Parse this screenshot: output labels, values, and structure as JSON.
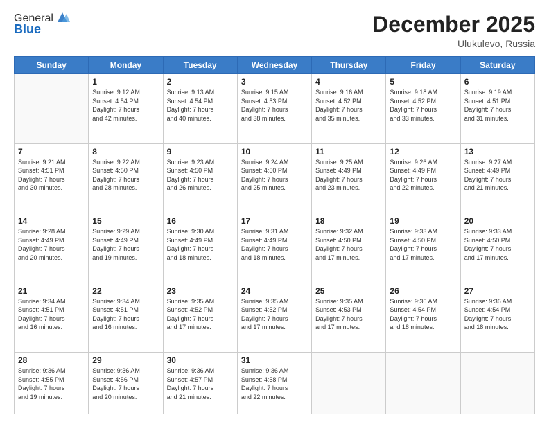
{
  "logo": {
    "general": "General",
    "blue": "Blue"
  },
  "header": {
    "month": "December 2025",
    "location": "Ulukulevo, Russia"
  },
  "weekdays": [
    "Sunday",
    "Monday",
    "Tuesday",
    "Wednesday",
    "Thursday",
    "Friday",
    "Saturday"
  ],
  "weeks": [
    [
      {
        "day": null,
        "info": null
      },
      {
        "day": "1",
        "sunrise": "Sunrise: 9:12 AM",
        "sunset": "Sunset: 4:54 PM",
        "daylight": "Daylight: 7 hours and 42 minutes."
      },
      {
        "day": "2",
        "sunrise": "Sunrise: 9:13 AM",
        "sunset": "Sunset: 4:54 PM",
        "daylight": "Daylight: 7 hours and 40 minutes."
      },
      {
        "day": "3",
        "sunrise": "Sunrise: 9:15 AM",
        "sunset": "Sunset: 4:53 PM",
        "daylight": "Daylight: 7 hours and 38 minutes."
      },
      {
        "day": "4",
        "sunrise": "Sunrise: 9:16 AM",
        "sunset": "Sunset: 4:52 PM",
        "daylight": "Daylight: 7 hours and 35 minutes."
      },
      {
        "day": "5",
        "sunrise": "Sunrise: 9:18 AM",
        "sunset": "Sunset: 4:52 PM",
        "daylight": "Daylight: 7 hours and 33 minutes."
      },
      {
        "day": "6",
        "sunrise": "Sunrise: 9:19 AM",
        "sunset": "Sunset: 4:51 PM",
        "daylight": "Daylight: 7 hours and 31 minutes."
      }
    ],
    [
      {
        "day": "7",
        "sunrise": "Sunrise: 9:21 AM",
        "sunset": "Sunset: 4:51 PM",
        "daylight": "Daylight: 7 hours and 30 minutes."
      },
      {
        "day": "8",
        "sunrise": "Sunrise: 9:22 AM",
        "sunset": "Sunset: 4:50 PM",
        "daylight": "Daylight: 7 hours and 28 minutes."
      },
      {
        "day": "9",
        "sunrise": "Sunrise: 9:23 AM",
        "sunset": "Sunset: 4:50 PM",
        "daylight": "Daylight: 7 hours and 26 minutes."
      },
      {
        "day": "10",
        "sunrise": "Sunrise: 9:24 AM",
        "sunset": "Sunset: 4:50 PM",
        "daylight": "Daylight: 7 hours and 25 minutes."
      },
      {
        "day": "11",
        "sunrise": "Sunrise: 9:25 AM",
        "sunset": "Sunset: 4:49 PM",
        "daylight": "Daylight: 7 hours and 23 minutes."
      },
      {
        "day": "12",
        "sunrise": "Sunrise: 9:26 AM",
        "sunset": "Sunset: 4:49 PM",
        "daylight": "Daylight: 7 hours and 22 minutes."
      },
      {
        "day": "13",
        "sunrise": "Sunrise: 9:27 AM",
        "sunset": "Sunset: 4:49 PM",
        "daylight": "Daylight: 7 hours and 21 minutes."
      }
    ],
    [
      {
        "day": "14",
        "sunrise": "Sunrise: 9:28 AM",
        "sunset": "Sunset: 4:49 PM",
        "daylight": "Daylight: 7 hours and 20 minutes."
      },
      {
        "day": "15",
        "sunrise": "Sunrise: 9:29 AM",
        "sunset": "Sunset: 4:49 PM",
        "daylight": "Daylight: 7 hours and 19 minutes."
      },
      {
        "day": "16",
        "sunrise": "Sunrise: 9:30 AM",
        "sunset": "Sunset: 4:49 PM",
        "daylight": "Daylight: 7 hours and 18 minutes."
      },
      {
        "day": "17",
        "sunrise": "Sunrise: 9:31 AM",
        "sunset": "Sunset: 4:49 PM",
        "daylight": "Daylight: 7 hours and 18 minutes."
      },
      {
        "day": "18",
        "sunrise": "Sunrise: 9:32 AM",
        "sunset": "Sunset: 4:50 PM",
        "daylight": "Daylight: 7 hours and 17 minutes."
      },
      {
        "day": "19",
        "sunrise": "Sunrise: 9:33 AM",
        "sunset": "Sunset: 4:50 PM",
        "daylight": "Daylight: 7 hours and 17 minutes."
      },
      {
        "day": "20",
        "sunrise": "Sunrise: 9:33 AM",
        "sunset": "Sunset: 4:50 PM",
        "daylight": "Daylight: 7 hours and 17 minutes."
      }
    ],
    [
      {
        "day": "21",
        "sunrise": "Sunrise: 9:34 AM",
        "sunset": "Sunset: 4:51 PM",
        "daylight": "Daylight: 7 hours and 16 minutes."
      },
      {
        "day": "22",
        "sunrise": "Sunrise: 9:34 AM",
        "sunset": "Sunset: 4:51 PM",
        "daylight": "Daylight: 7 hours and 16 minutes."
      },
      {
        "day": "23",
        "sunrise": "Sunrise: 9:35 AM",
        "sunset": "Sunset: 4:52 PM",
        "daylight": "Daylight: 7 hours and 17 minutes."
      },
      {
        "day": "24",
        "sunrise": "Sunrise: 9:35 AM",
        "sunset": "Sunset: 4:52 PM",
        "daylight": "Daylight: 7 hours and 17 minutes."
      },
      {
        "day": "25",
        "sunrise": "Sunrise: 9:35 AM",
        "sunset": "Sunset: 4:53 PM",
        "daylight": "Daylight: 7 hours and 17 minutes."
      },
      {
        "day": "26",
        "sunrise": "Sunrise: 9:36 AM",
        "sunset": "Sunset: 4:54 PM",
        "daylight": "Daylight: 7 hours and 18 minutes."
      },
      {
        "day": "27",
        "sunrise": "Sunrise: 9:36 AM",
        "sunset": "Sunset: 4:54 PM",
        "daylight": "Daylight: 7 hours and 18 minutes."
      }
    ],
    [
      {
        "day": "28",
        "sunrise": "Sunrise: 9:36 AM",
        "sunset": "Sunset: 4:55 PM",
        "daylight": "Daylight: 7 hours and 19 minutes."
      },
      {
        "day": "29",
        "sunrise": "Sunrise: 9:36 AM",
        "sunset": "Sunset: 4:56 PM",
        "daylight": "Daylight: 7 hours and 20 minutes."
      },
      {
        "day": "30",
        "sunrise": "Sunrise: 9:36 AM",
        "sunset": "Sunset: 4:57 PM",
        "daylight": "Daylight: 7 hours and 21 minutes."
      },
      {
        "day": "31",
        "sunrise": "Sunrise: 9:36 AM",
        "sunset": "Sunset: 4:58 PM",
        "daylight": "Daylight: 7 hours and 22 minutes."
      },
      {
        "day": null,
        "info": null
      },
      {
        "day": null,
        "info": null
      },
      {
        "day": null,
        "info": null
      }
    ]
  ]
}
